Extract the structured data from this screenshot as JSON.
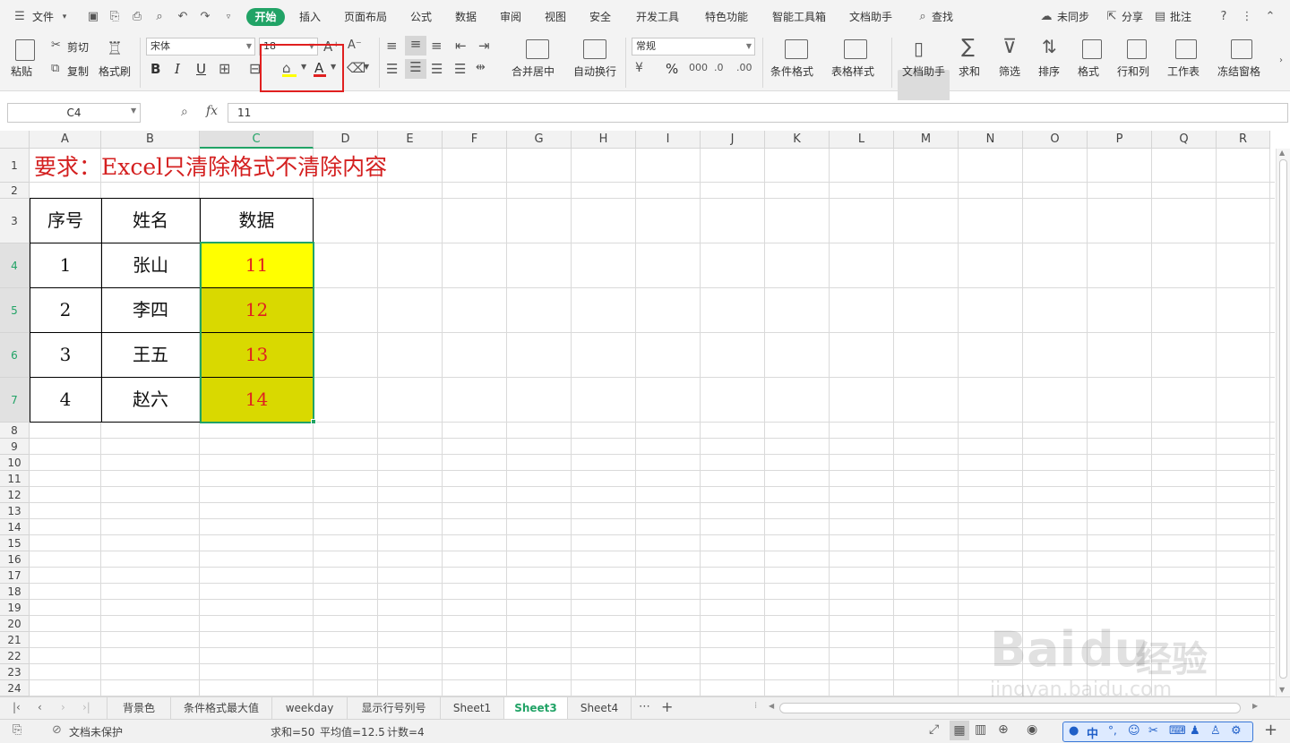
{
  "menu": {
    "file": "文件",
    "tabs": [
      "开始",
      "插入",
      "页面布局",
      "公式",
      "数据",
      "审阅",
      "视图",
      "安全",
      "开发工具",
      "特色功能",
      "智能工具箱",
      "文档助手"
    ],
    "search": "查找",
    "sync": "未同步",
    "share": "分享",
    "comment": "批注"
  },
  "ribbon": {
    "paste": "粘贴",
    "cut": "剪切",
    "copy": "复制",
    "format_painter": "格式刷",
    "font_name": "宋体",
    "font_size": "18",
    "number_format": "常规",
    "merge_center": "合并居中",
    "wrap_text": "自动换行",
    "conditional_format": "条件格式",
    "table_style": "表格样式",
    "doc_assistant": "文档助手",
    "sum": "求和",
    "filter": "筛选",
    "sort": "排序",
    "format": "格式",
    "rows_cols": "行和列",
    "worksheet": "工作表",
    "freeze": "冻结窗格",
    "bold": "B",
    "italic": "I",
    "underline": "U",
    "font_color_glyph": "A",
    "percent": "%"
  },
  "formula_bar": {
    "name_box": "C4",
    "fx": "fx",
    "value": "11"
  },
  "columns": [
    "A",
    "B",
    "C",
    "D",
    "E",
    "F",
    "G",
    "H",
    "I",
    "J",
    "K",
    "L",
    "M",
    "N",
    "O",
    "P",
    "Q",
    "R"
  ],
  "rows": [
    "1",
    "2",
    "3",
    "4",
    "5",
    "6",
    "7",
    "8",
    "9",
    "10",
    "11",
    "12",
    "13",
    "14",
    "15",
    "16",
    "17",
    "18",
    "19",
    "20",
    "21",
    "22",
    "23",
    "24"
  ],
  "sheet": {
    "title": "要求：Excel只清除格式不清除内容",
    "headers": [
      "序号",
      "姓名",
      "数据"
    ],
    "table": [
      {
        "no": "1",
        "name": "张山",
        "data": "11"
      },
      {
        "no": "2",
        "name": "李四",
        "data": "12"
      },
      {
        "no": "3",
        "name": "王五",
        "data": "13"
      },
      {
        "no": "4",
        "name": "赵六",
        "data": "14"
      }
    ]
  },
  "colors": {
    "accent": "#21a366",
    "title_red": "#d42020",
    "data_red": "#e02020",
    "highlight_yellow": "#ffff00",
    "selection_fill": "#d9d900",
    "annotation_box": "#e02020"
  },
  "sheet_tabs": [
    "背景色",
    "条件格式最大值",
    "weekday",
    "显示行号列号",
    "Sheet1",
    "Sheet3",
    "Sheet4"
  ],
  "active_sheet": "Sheet3",
  "status": {
    "protection": "文档未保护",
    "sum": "求和=50",
    "average": "平均值=12.5",
    "count": "计数=4",
    "ime_lang": "中"
  },
  "watermark": {
    "brand": "Bai",
    "brand2": "du",
    "product": "经验",
    "url": "jingyan.baidu.com"
  }
}
